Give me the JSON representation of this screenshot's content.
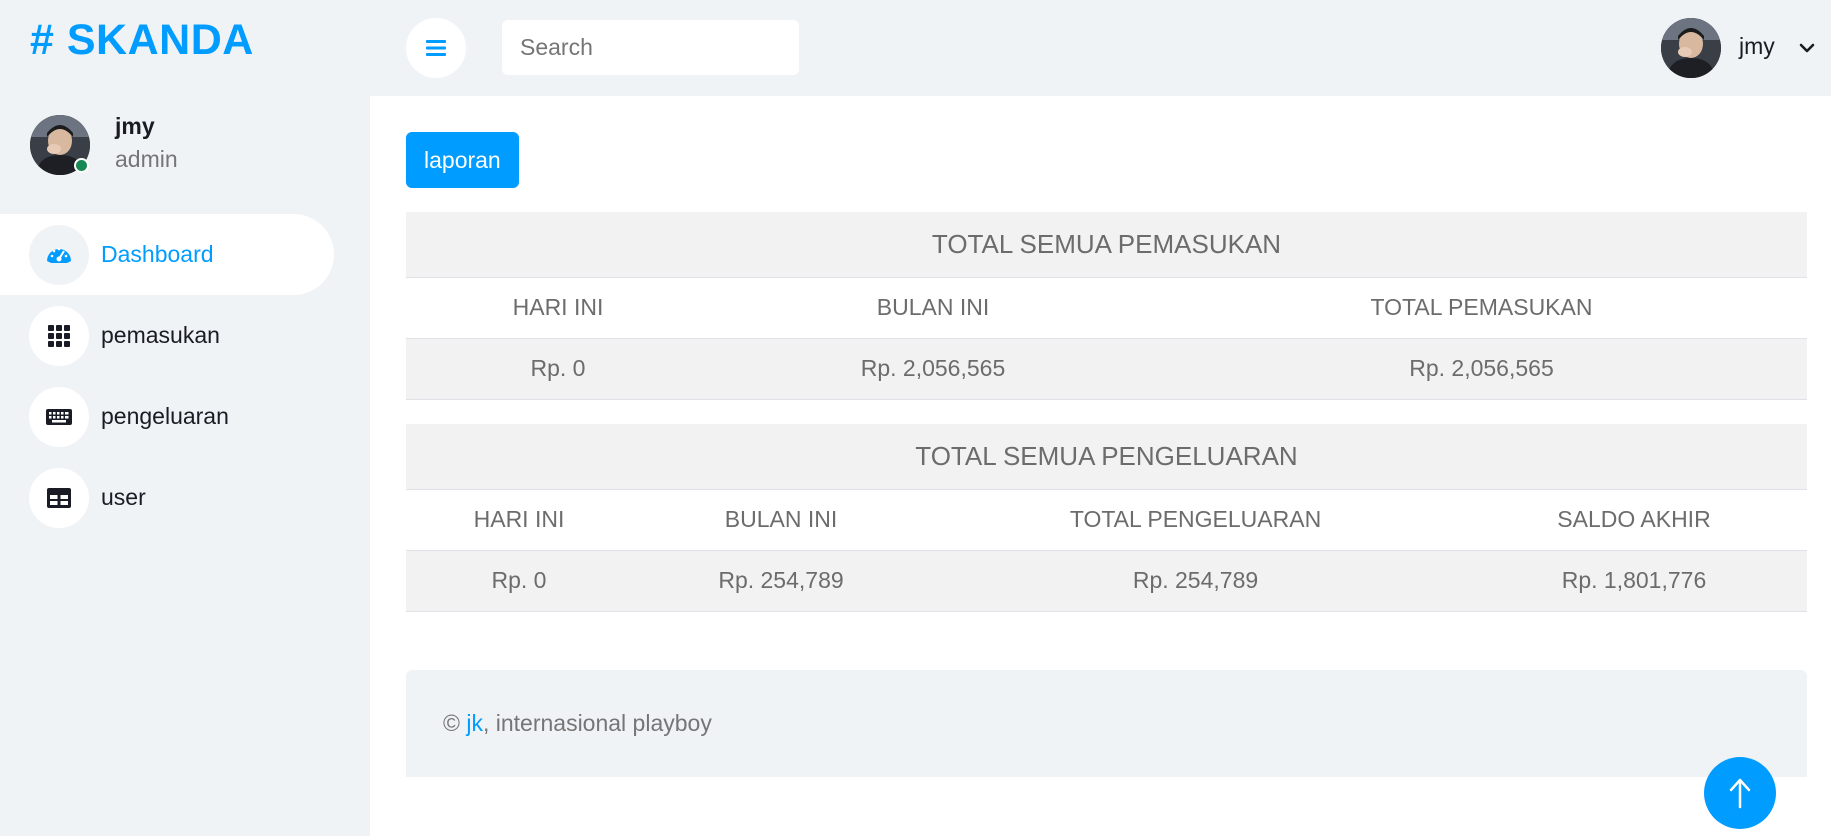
{
  "brand": {
    "symbol": "#",
    "name": "SKANDA"
  },
  "profile": {
    "name": "jmy",
    "role": "admin",
    "avatar_icon": "user-photo-icon",
    "status": "online"
  },
  "sidebar": {
    "items": [
      {
        "label": "Dashboard",
        "icon": "speedometer-icon",
        "active": true
      },
      {
        "label": "pemasukan",
        "icon": "grid-icon",
        "active": false
      },
      {
        "label": "pengeluaran",
        "icon": "keyboard-icon",
        "active": false
      },
      {
        "label": "user",
        "icon": "table-icon",
        "active": false
      }
    ]
  },
  "topbar": {
    "toggle_icon": "hamburger-menu-icon",
    "search_placeholder": "Search",
    "user_name": "jmy"
  },
  "main": {
    "report_button": "laporan",
    "income": {
      "title": "TOTAL SEMUA PEMASUKAN",
      "headers": [
        "HARI INI",
        "BULAN INI",
        "TOTAL PEMASUKAN"
      ],
      "values": [
        "Rp. 0",
        "Rp. 2,056,565",
        "Rp. 2,056,565"
      ]
    },
    "expense": {
      "title": "TOTAL SEMUA PENGELUARAN",
      "headers": [
        "HARI INI",
        "BULAN INI",
        "TOTAL PENGELUARAN",
        "SALDO AKHIR"
      ],
      "values": [
        "Rp. 0",
        "Rp. 254,789",
        "Rp. 254,789",
        "Rp. 1,801,776"
      ]
    }
  },
  "footer": {
    "copyright": "©",
    "link_text": "jk",
    "suffix": ", internasional playboy"
  },
  "colors": {
    "primary": "#009cff",
    "sidebar_bg": "#f0f3f6",
    "online": "#198754",
    "table_stripe": "#f2f2f2"
  }
}
